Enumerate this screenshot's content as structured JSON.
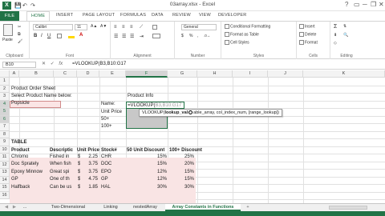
{
  "window": {
    "title": "03array.xlsx - Excel",
    "help": "?",
    "minimize": "─",
    "restore": "❐",
    "close": "✕",
    "ribbon_collapse": "▭"
  },
  "qat": {
    "save": "💾",
    "undo": "↶",
    "redo": "↷"
  },
  "tabs": [
    "FILE",
    "HOME",
    "INSERT",
    "PAGE LAYOUT",
    "FORMULAS",
    "DATA",
    "REVIEW",
    "VIEW",
    "DEVELOPER"
  ],
  "ribbon": {
    "clipboard": {
      "label": "Clipboard",
      "paste": "Paste"
    },
    "font": {
      "label": "Font",
      "name": "Calibri",
      "size": "11",
      "bold": "B",
      "italic": "I",
      "underline": "U"
    },
    "alignment": {
      "label": "Alignment"
    },
    "number": {
      "label": "Number",
      "format": "General",
      "currency": "$",
      "percent": "%",
      "comma": ","
    },
    "styles": {
      "label": "Styles",
      "conditional": "Conditional Formatting",
      "format_table": "Format as Table",
      "cell_styles": "Cell Styles"
    },
    "cells": {
      "label": "Cells",
      "insert": "Insert",
      "delete": "Delete",
      "format": "Format"
    },
    "editing": {
      "label": "Editing"
    }
  },
  "formula_bar": {
    "name_box": "B10",
    "cancel": "✕",
    "enter": "✓",
    "fx": "fx",
    "formula": "=VLOOKUP(B3,B10:G17"
  },
  "columns": [
    "A",
    "B",
    "C",
    "D",
    "E",
    "F",
    "G",
    "H",
    "I",
    "J",
    "K"
  ],
  "rows": [
    "1",
    "2",
    "3",
    "4",
    "5",
    "6",
    "7",
    "8",
    "9",
    "10",
    "11",
    "12",
    "13",
    "14",
    "15",
    "16"
  ],
  "cells": {
    "b1": "Product Order Sheet",
    "b2": "Select Product Name below:",
    "f2": "Product Info",
    "b3": "Popsicle",
    "e3": "Name:",
    "f3_prefix": "=VLOOKUP(",
    "f3_ref": "B3,B10:G17",
    "e4": "Unit Price",
    "e5": "50+",
    "e6": "100+",
    "b8": "TABLE",
    "headers": [
      "Product",
      "Descriptic",
      "Unit Price",
      "Stock#",
      "50 Unit Discount",
      "100+ Discount"
    ]
  },
  "table_rows": [
    {
      "product": "Chromo",
      "desc": "Fished in",
      "cur": "$",
      "price": "2.25",
      "stock": "CHR",
      "d50": "15%",
      "d100": "25%"
    },
    {
      "product": "Doc Sprately",
      "desc": "When fish",
      "cur": "$",
      "price": "3.75",
      "stock": "DOC",
      "d50": "15%",
      "d100": "20%"
    },
    {
      "product": "Epoxy Minnow",
      "desc": "Great spi",
      "cur": "$",
      "price": "3.75",
      "stock": "EPO",
      "d50": "12%",
      "d100": "15%"
    },
    {
      "product": "GP",
      "desc": "One of th",
      "cur": "$",
      "price": "4.75",
      "stock": "GP",
      "d50": "12%",
      "d100": "15%"
    },
    {
      "product": "Halfback",
      "desc": "Can be us",
      "cur": "$",
      "price": "1.85",
      "stock": "HAL",
      "d50": "30%",
      "d100": "30%"
    }
  ],
  "tooltip": {
    "func": "VLOOKUP(",
    "arg1": "lookup_val",
    "rest": "able_array, col_index_num, [range_lookup])"
  },
  "sheet_tabs": [
    "Two-Dimensional",
    "Linking",
    "nestedArray",
    "Array Constants in Functions"
  ],
  "sheet_nav": {
    "prev": "◀",
    "next": "▶",
    "more": "...",
    "add": "+"
  }
}
